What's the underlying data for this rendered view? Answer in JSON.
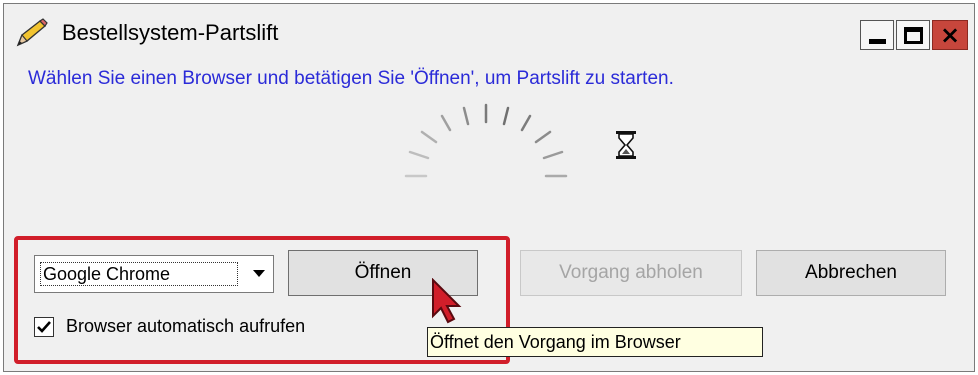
{
  "window": {
    "title": "Bestellsystem-Partslift",
    "icon": "pencil-icon",
    "controls": {
      "minimize": "minimize-icon",
      "maximize": "maximize-icon",
      "close": "×"
    }
  },
  "main": {
    "instruction": "Wählen Sie einen Browser und betätigen Sie 'Öffnen', um Partslift zu starten.",
    "colors": {
      "instruction_text": "#2b2bd8",
      "highlight_border": "#d11e2a",
      "close_button": "#c7463c",
      "tooltip_bg": "#ffffe1"
    },
    "loading_indicators": [
      "spinner-icon",
      "hourglass-icon"
    ]
  },
  "controls": {
    "browser_select": {
      "value": "Google Chrome"
    },
    "open_button": "Öffnen",
    "fetch_button": "Vorgang abholen",
    "cancel_button": "Abbrechen",
    "auto_open_checkbox": {
      "label": "Browser automatisch aufrufen",
      "checked": true
    }
  },
  "tooltip": {
    "text": "Öffnet den Vorgang im Browser"
  }
}
